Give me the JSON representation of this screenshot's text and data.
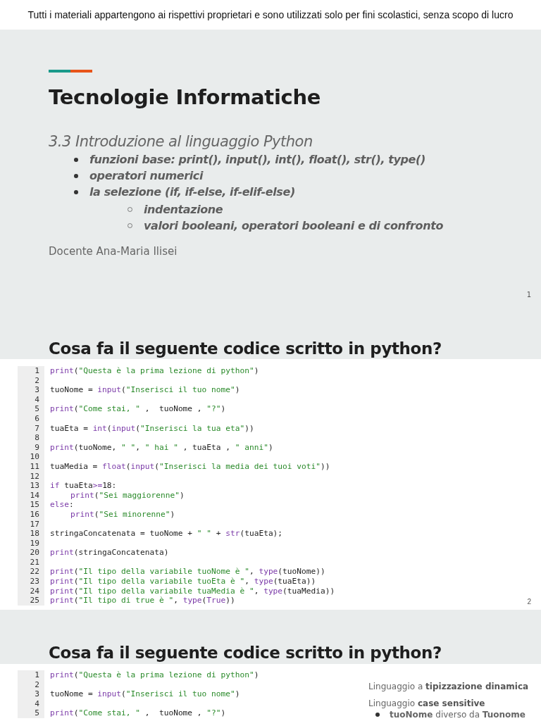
{
  "notice": "Tutti i materiali appartengono ai rispettivi proprietari e sono utilizzati solo per fini scolastici, senza scopo di lucro",
  "slides": [
    {
      "kind": "title",
      "title": "Tecnologie Informatiche",
      "subtitle": "3.3 Introduzione al linguaggio Python",
      "bullets": [
        {
          "text": "funzioni base: print(), input(), int(), float(), str(), type()"
        },
        {
          "text": "operatori numerici"
        },
        {
          "text": "la selezione (if, if-else, if-elif-else)",
          "children": [
            {
              "text": "indentazione"
            },
            {
              "text": "valori booleani, operatori booleani e di confronto"
            }
          ]
        }
      ],
      "author": "Docente Ana-Maria Ilisei",
      "page": "1"
    },
    {
      "kind": "code",
      "title": "Cosa fa il seguente codice scritto in python?",
      "page": "2",
      "code": [
        {
          "n": "1",
          "tokens": [
            {
              "kind": "fn",
              "text": "print"
            },
            {
              "kind": "p",
              "text": "("
            },
            {
              "kind": "str",
              "text": "\"Questa è la prima lezione di python\""
            },
            {
              "kind": "p",
              "text": ")"
            }
          ]
        },
        {
          "n": "2"
        },
        {
          "n": "3",
          "tokens": [
            {
              "kind": "p",
              "text": "tuoNome = "
            },
            {
              "kind": "fn",
              "text": "input"
            },
            {
              "kind": "p",
              "text": "("
            },
            {
              "kind": "str",
              "text": "\"Inserisci il tuo nome\""
            },
            {
              "kind": "p",
              "text": ")"
            }
          ]
        },
        {
          "n": "4"
        },
        {
          "n": "5",
          "tokens": [
            {
              "kind": "fn",
              "text": "print"
            },
            {
              "kind": "p",
              "text": "("
            },
            {
              "kind": "str",
              "text": "\"Come stai, \""
            },
            {
              "kind": "p",
              "text": " ,  tuoNome , "
            },
            {
              "kind": "str",
              "text": "\"?\""
            },
            {
              "kind": "p",
              "text": ")"
            }
          ]
        },
        {
          "n": "6"
        },
        {
          "n": "7",
          "tokens": [
            {
              "kind": "p",
              "text": "tuaEta = "
            },
            {
              "kind": "fn",
              "text": "int"
            },
            {
              "kind": "p",
              "text": "("
            },
            {
              "kind": "fn",
              "text": "input"
            },
            {
              "kind": "p",
              "text": "("
            },
            {
              "kind": "str",
              "text": "\"Inserisci la tua eta\""
            },
            {
              "kind": "p",
              "text": "))"
            }
          ]
        },
        {
          "n": "8"
        },
        {
          "n": "9",
          "tokens": [
            {
              "kind": "fn",
              "text": "print"
            },
            {
              "kind": "p",
              "text": "(tuoNome, "
            },
            {
              "kind": "str",
              "text": "\" \""
            },
            {
              "kind": "p",
              "text": ", "
            },
            {
              "kind": "str",
              "text": "\" hai \""
            },
            {
              "kind": "p",
              "text": " , tuaEta , "
            },
            {
              "kind": "str",
              "text": "\" anni\""
            },
            {
              "kind": "p",
              "text": ")"
            }
          ]
        },
        {
          "n": "10"
        },
        {
          "n": "11",
          "tokens": [
            {
              "kind": "p",
              "text": "tuaMedia = "
            },
            {
              "kind": "fn",
              "text": "float"
            },
            {
              "kind": "p",
              "text": "("
            },
            {
              "kind": "fn",
              "text": "input"
            },
            {
              "kind": "p",
              "text": "("
            },
            {
              "kind": "str",
              "text": "\"Inserisci la media dei tuoi voti\""
            },
            {
              "kind": "p",
              "text": "))"
            }
          ]
        },
        {
          "n": "12"
        },
        {
          "n": "13",
          "tokens": [
            {
              "kind": "fn",
              "text": "if"
            },
            {
              "kind": "p",
              "text": " tuaEta"
            },
            {
              "kind": "fn",
              "text": ">="
            },
            {
              "kind": "p",
              "text": "18:"
            }
          ]
        },
        {
          "n": "14",
          "indent": true,
          "tokens": [
            {
              "kind": "fn",
              "text": "print"
            },
            {
              "kind": "p",
              "text": "("
            },
            {
              "kind": "str",
              "text": "\"Sei maggiorenne\""
            },
            {
              "kind": "p",
              "text": ")"
            }
          ]
        },
        {
          "n": "15",
          "tokens": [
            {
              "kind": "fn",
              "text": "else"
            },
            {
              "kind": "p",
              "text": ":"
            }
          ]
        },
        {
          "n": "16",
          "indent": true,
          "tokens": [
            {
              "kind": "fn",
              "text": "print"
            },
            {
              "kind": "p",
              "text": "("
            },
            {
              "kind": "str",
              "text": "\"Sei minorenne\""
            },
            {
              "kind": "p",
              "text": ")"
            }
          ]
        },
        {
          "n": "17"
        },
        {
          "n": "18",
          "tokens": [
            {
              "kind": "p",
              "text": "stringaConcatenata = tuoNome + "
            },
            {
              "kind": "str",
              "text": "\" \""
            },
            {
              "kind": "p",
              "text": " + "
            },
            {
              "kind": "fn",
              "text": "str"
            },
            {
              "kind": "p",
              "text": "(tuaEta);"
            }
          ]
        },
        {
          "n": "19"
        },
        {
          "n": "20",
          "tokens": [
            {
              "kind": "fn",
              "text": "print"
            },
            {
              "kind": "p",
              "text": "(stringaConcatenata)"
            }
          ]
        },
        {
          "n": "21"
        },
        {
          "n": "22",
          "tokens": [
            {
              "kind": "fn",
              "text": "print"
            },
            {
              "kind": "p",
              "text": "("
            },
            {
              "kind": "str",
              "text": "\"Il tipo della variabile tuoNome è \""
            },
            {
              "kind": "p",
              "text": ", "
            },
            {
              "kind": "fn",
              "text": "type"
            },
            {
              "kind": "p",
              "text": "(tuoNome))"
            }
          ]
        },
        {
          "n": "23",
          "tokens": [
            {
              "kind": "fn",
              "text": "print"
            },
            {
              "kind": "p",
              "text": "("
            },
            {
              "kind": "str",
              "text": "\"Il tipo della variabile tuoEta è \""
            },
            {
              "kind": "p",
              "text": ", "
            },
            {
              "kind": "fn",
              "text": "type"
            },
            {
              "kind": "p",
              "text": "(tuaEta))"
            }
          ]
        },
        {
          "n": "24",
          "tokens": [
            {
              "kind": "fn",
              "text": "print"
            },
            {
              "kind": "p",
              "text": "("
            },
            {
              "kind": "str",
              "text": "\"Il tipo della variabile tuaMedia è \""
            },
            {
              "kind": "p",
              "text": ", "
            },
            {
              "kind": "fn",
              "text": "type"
            },
            {
              "kind": "p",
              "text": "(tuaMedia))"
            }
          ]
        },
        {
          "n": "25",
          "tokens": [
            {
              "kind": "fn",
              "text": "print"
            },
            {
              "kind": "p",
              "text": "("
            },
            {
              "kind": "str",
              "text": "\"Il tipo di true è \""
            },
            {
              "kind": "p",
              "text": ", "
            },
            {
              "kind": "fn",
              "text": "type"
            },
            {
              "kind": "p",
              "text": "("
            },
            {
              "kind": "fn",
              "text": "True"
            },
            {
              "kind": "p",
              "text": "))"
            }
          ]
        }
      ]
    },
    {
      "kind": "code",
      "title": "Cosa fa il seguente codice scritto in python?",
      "code": [
        {
          "n": "1",
          "tokens": [
            {
              "kind": "fn",
              "text": "print"
            },
            {
              "kind": "p",
              "text": "("
            },
            {
              "kind": "str",
              "text": "\"Questa è la prima lezione di python\""
            },
            {
              "kind": "p",
              "text": ")"
            }
          ]
        },
        {
          "n": "2"
        },
        {
          "n": "3",
          "tokens": [
            {
              "kind": "p",
              "text": "tuoNome = "
            },
            {
              "kind": "fn",
              "text": "input"
            },
            {
              "kind": "p",
              "text": "("
            },
            {
              "kind": "str",
              "text": "\"Inserisci il tuo nome\""
            },
            {
              "kind": "p",
              "text": ")"
            }
          ]
        },
        {
          "n": "4"
        },
        {
          "n": "5",
          "tokens": [
            {
              "kind": "fn",
              "text": "print"
            },
            {
              "kind": "p",
              "text": "("
            },
            {
              "kind": "str",
              "text": "\"Come stai, \""
            },
            {
              "kind": "p",
              "text": " ,  tuoNome , "
            },
            {
              "kind": "str",
              "text": "\"?\""
            },
            {
              "kind": "p",
              "text": ")"
            }
          ]
        }
      ],
      "notes": [
        {
          "text": "Linguaggio a **tipizzazione dinamica**"
        },
        {
          "text": "Linguaggio **case sensitive**",
          "children": [
            {
              "text": "**tuoNome** diverso da **Tuonome**"
            }
          ]
        }
      ]
    }
  ]
}
